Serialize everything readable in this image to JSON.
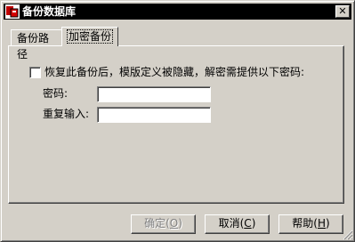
{
  "window": {
    "title": "备份数据库",
    "close_label": "✕"
  },
  "tabs": [
    {
      "label": "备份路径",
      "active": false
    },
    {
      "label": "加密备份",
      "active": true
    }
  ],
  "encrypt": {
    "checkbox_label": "恢复此备份后，模版定义被隐藏，解密需提供以下密码:",
    "checked": false,
    "password_label": "密码:",
    "password_value": "",
    "repeat_label": "重复输入:",
    "repeat_value": ""
  },
  "buttons": {
    "ok": {
      "text": "确定(",
      "key": "O",
      "tail": ")",
      "enabled": false
    },
    "cancel": {
      "text": "取消(",
      "key": "C",
      "tail": ")",
      "enabled": true
    },
    "help": {
      "text": "帮助(",
      "key": "H",
      "tail": ")",
      "enabled": true
    }
  },
  "icons": {
    "app": "app-icon",
    "close": "close-icon",
    "grip": "size-grip-icon"
  }
}
